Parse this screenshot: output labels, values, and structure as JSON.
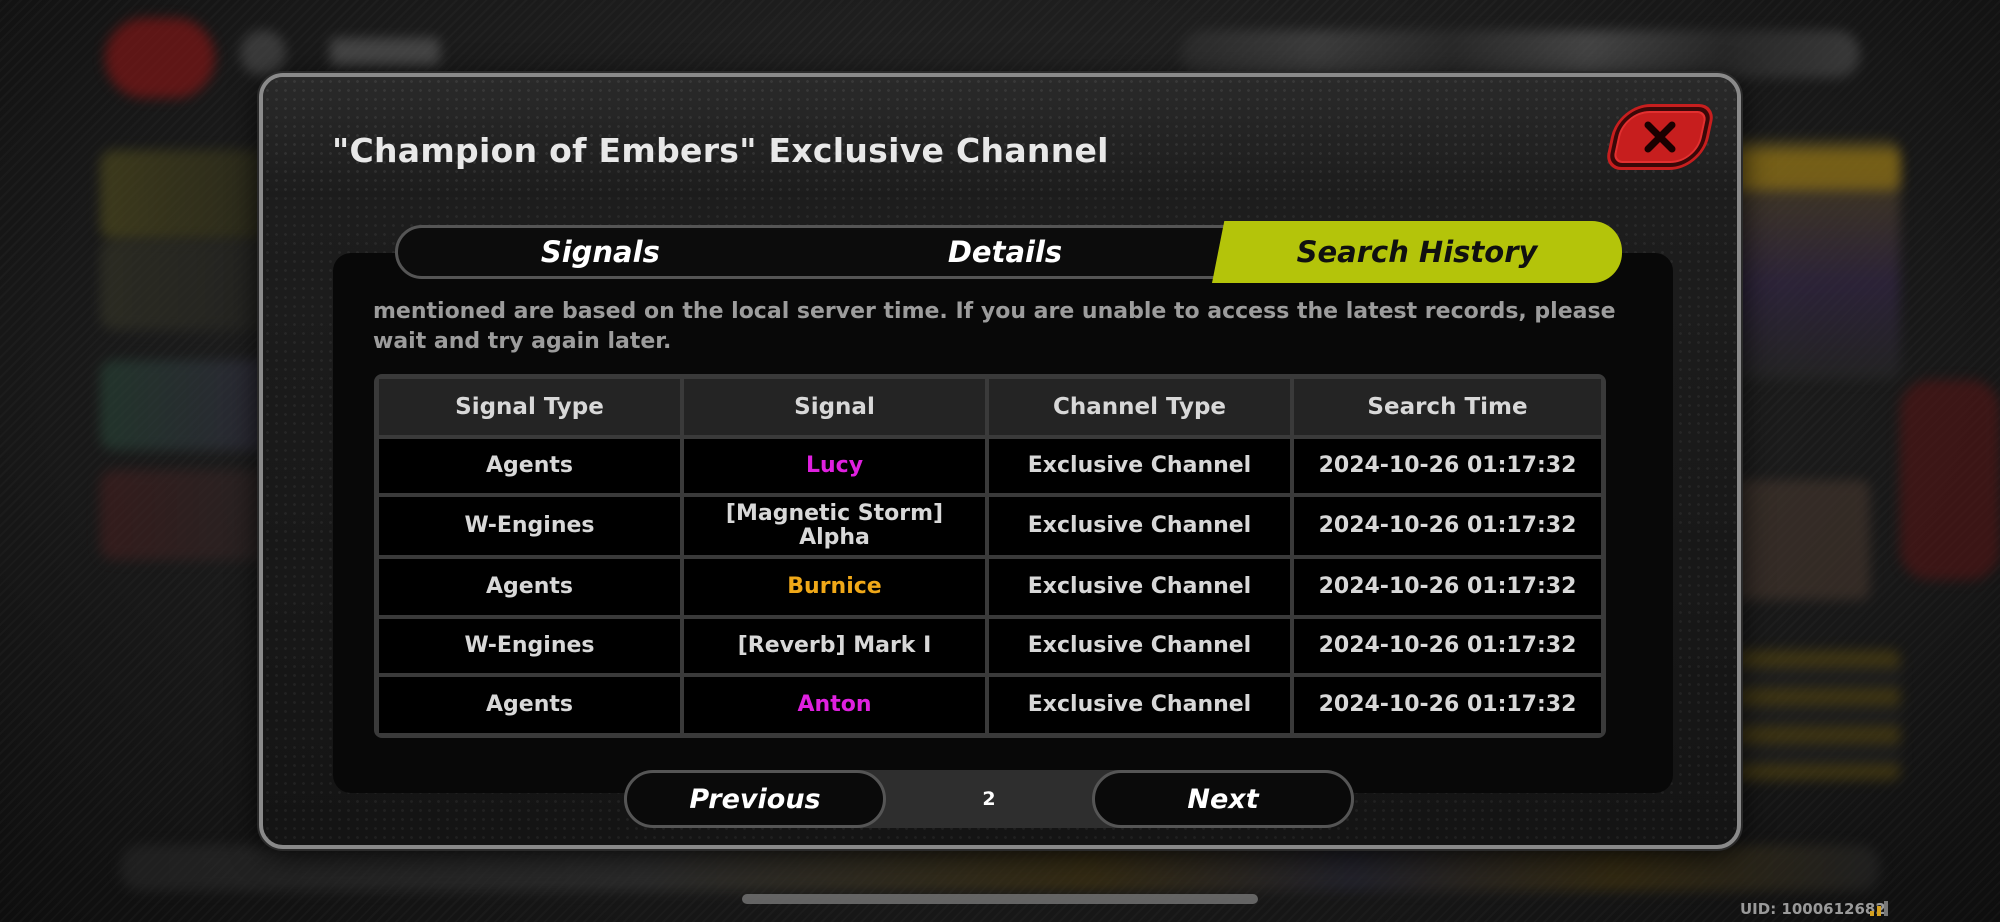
{
  "modal": {
    "title": "\"Champion of Embers\" Exclusive Channel",
    "close_icon": "close-x-icon"
  },
  "tabs": [
    {
      "label": "Signals",
      "active": false
    },
    {
      "label": "Details",
      "active": false
    },
    {
      "label": "Search History",
      "active": true
    }
  ],
  "notice": "mentioned are based on the local server time. If you are unable to access the latest records, please wait and try again later.",
  "table": {
    "headers": [
      "Signal Type",
      "Signal",
      "Channel Type",
      "Search Time"
    ],
    "rows": [
      {
        "signal_type": "Agents",
        "signal": "Lucy",
        "signal_color": "#e020e0",
        "channel_type": "Exclusive Channel",
        "search_time": "2024-10-26 01:17:32"
      },
      {
        "signal_type": "W-Engines",
        "signal": "[Magnetic Storm] Alpha",
        "signal_color": "#d8d8d8",
        "channel_type": "Exclusive Channel",
        "search_time": "2024-10-26 01:17:32"
      },
      {
        "signal_type": "Agents",
        "signal": "Burnice",
        "signal_color": "#f0a818",
        "channel_type": "Exclusive Channel",
        "search_time": "2024-10-26 01:17:32"
      },
      {
        "signal_type": "W-Engines",
        "signal": "[Reverb] Mark I",
        "signal_color": "#d8d8d8",
        "channel_type": "Exclusive Channel",
        "search_time": "2024-10-26 01:17:32"
      },
      {
        "signal_type": "Agents",
        "signal": "Anton",
        "signal_color": "#e020e0",
        "channel_type": "Exclusive Channel",
        "search_time": "2024-10-26 01:17:32"
      }
    ]
  },
  "pagination": {
    "previous_label": "Previous",
    "page": "2",
    "next_label": "Next"
  },
  "footer": {
    "uid": "UID: 1000612682"
  },
  "colors": {
    "accent_tab": "#b4c40a",
    "close_red": "#c71e1e"
  }
}
